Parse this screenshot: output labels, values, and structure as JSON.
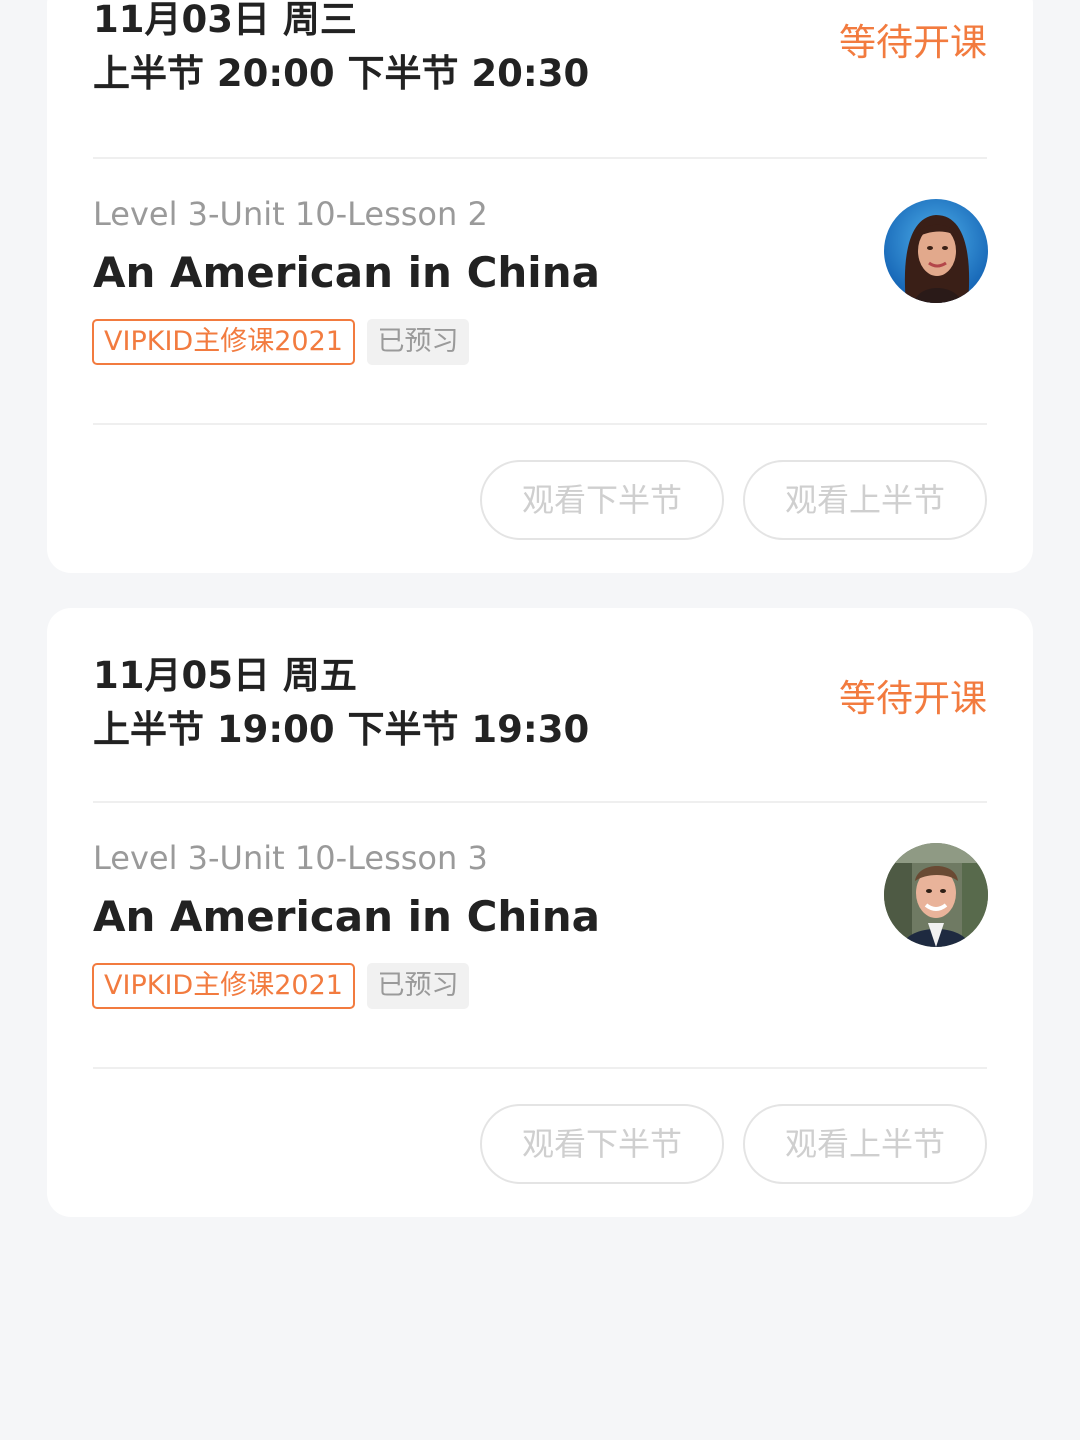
{
  "lessons": [
    {
      "date": "11月03日 周三",
      "times": "上半节 20:00 下半节 20:30",
      "status": "等待开课",
      "lesson_code": "Level 3-Unit 10-Lesson 2",
      "title": "An American in China",
      "course_tag": "VIPKID主修课2021",
      "preview_tag": "已预习",
      "watch_second_half": "观看下半节",
      "watch_first_half": "观看上半节"
    },
    {
      "date": "11月05日 周五",
      "times": "上半节 19:00 下半节 19:30",
      "status": "等待开课",
      "lesson_code": "Level 3-Unit 10-Lesson 3",
      "title": "An American in China",
      "course_tag": "VIPKID主修课2021",
      "preview_tag": "已预习",
      "watch_second_half": "观看下半节",
      "watch_first_half": "观看上半节"
    }
  ],
  "colors": {
    "accent": "#f27b3f",
    "background": "#f5f6f8",
    "card": "#ffffff",
    "disabled_text": "#cfcfcf"
  }
}
